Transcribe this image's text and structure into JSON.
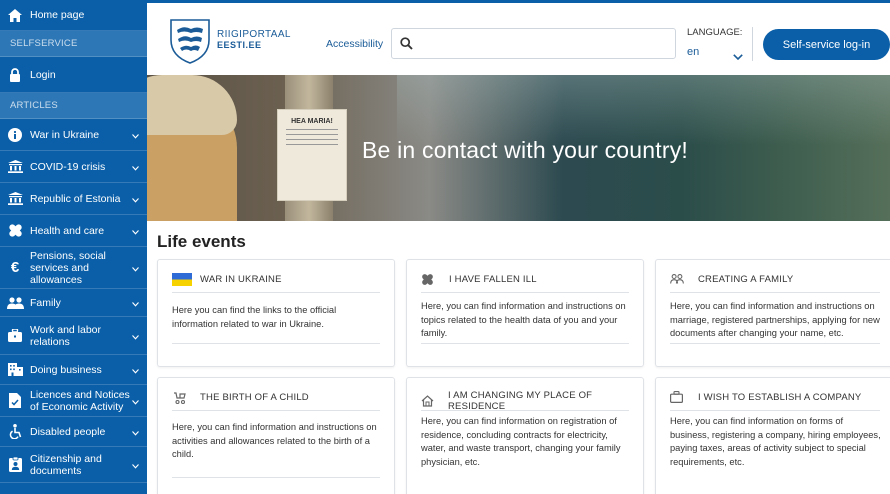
{
  "sidebar": {
    "home": "Home page",
    "selfservice_heading": "SELFSERVICE",
    "login": "Login",
    "articles_heading": "ARTICLES",
    "items": [
      {
        "label": "War in Ukraine",
        "icon": "info-icon"
      },
      {
        "label": "COVID-19 crisis",
        "icon": "institution-icon"
      },
      {
        "label": "Republic of Estonia",
        "icon": "institution-icon"
      },
      {
        "label": "Health and care",
        "icon": "health-icon"
      },
      {
        "label": "Pensions, social services and allowances",
        "icon": "euro-icon"
      },
      {
        "label": "Family",
        "icon": "family-icon"
      },
      {
        "label": "Work and labor relations",
        "icon": "briefcase-icon"
      },
      {
        "label": "Doing business",
        "icon": "building-icon"
      },
      {
        "label": "Licences and Notices of Economic Activity",
        "icon": "document-icon"
      },
      {
        "label": "Disabled people",
        "icon": "accessibility-icon"
      },
      {
        "label": "Citizenship and documents",
        "icon": "id-card-icon"
      }
    ]
  },
  "header": {
    "brand_line1": "RIIGIPORTAAL",
    "brand_line2": "EESTI.EE",
    "accessibility": "Accessibility",
    "search_placeholder": "",
    "language_label": "LANGUAGE:",
    "language_value": "en",
    "login_button": "Self-service log-in"
  },
  "hero": {
    "title": "Be in contact with your country!",
    "poster_text": "HEA MARIA!"
  },
  "life_events": {
    "title": "Life events",
    "cards": [
      {
        "title": "WAR IN UKRAINE",
        "icon": "ukraine-flag-icon",
        "body": "Here you can find the links to the official information related to war in Ukraine."
      },
      {
        "title": "I HAVE FALLEN ILL",
        "icon": "health-icon",
        "body": "Here, you can find information and instructions on topics related to the health data of you and your family."
      },
      {
        "title": "CREATING A FAMILY",
        "icon": "family-icon",
        "body": "Here, you can find information and instructions on marriage, registered partnerships, applying for new documents after changing your name, etc."
      },
      {
        "title": "THE BIRTH OF A CHILD",
        "icon": "baby-stroller-icon",
        "body": "Here, you can find information and instructions on activities and allowances related to the birth of a child."
      },
      {
        "title": "I AM CHANGING MY PLACE OF RESIDENCE",
        "icon": "home-icon",
        "body": "Here, you can find information on registration of residence, concluding contracts for electricity, water, and waste transport, changing your family physician, etc."
      },
      {
        "title": "I WISH TO ESTABLISH A COMPANY",
        "icon": "briefcase-icon",
        "body": "Here, you can find information on forms of business, registering a company, hiring employees, paying taxes, areas of activity subject to special requirements, etc."
      }
    ]
  },
  "colors": {
    "primary": "#0a5fa8",
    "section_bg": "#2d77b6",
    "link": "#1b5c98"
  }
}
